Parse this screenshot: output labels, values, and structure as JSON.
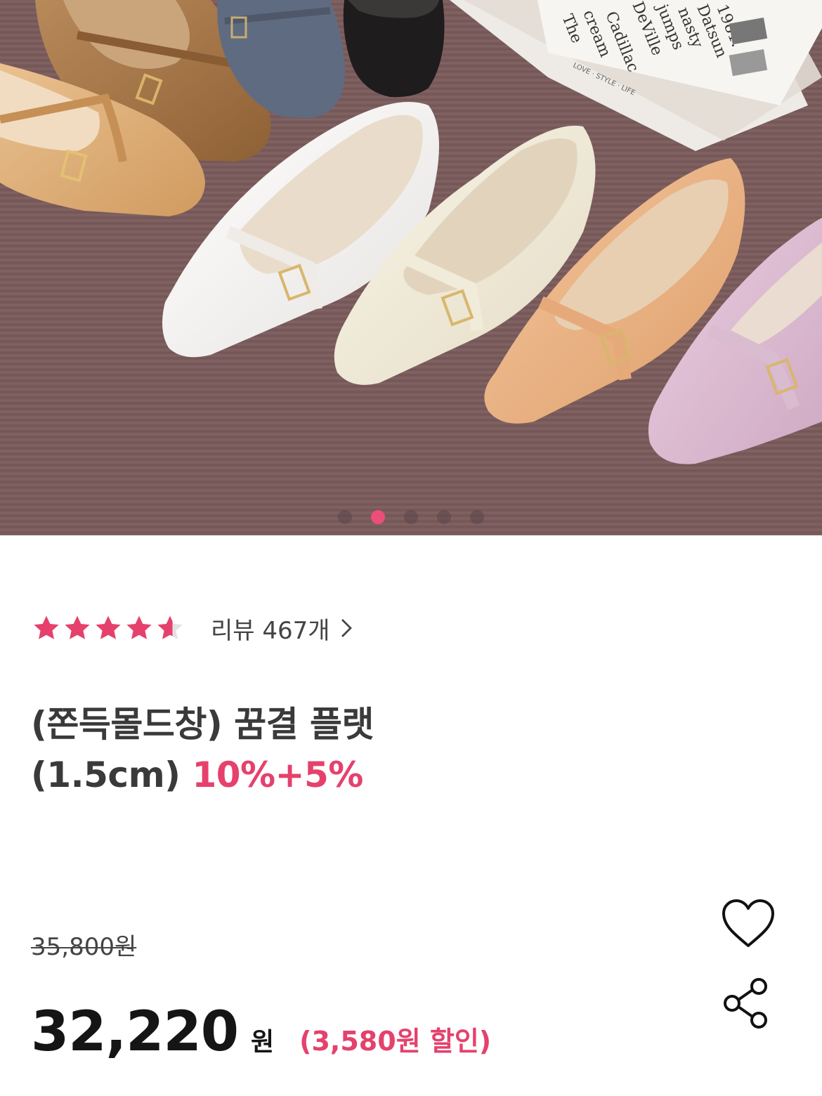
{
  "product_image": {
    "alt": "",
    "book_text": [
      "The",
      "cream",
      "Cadillac",
      "DeVille",
      "jumps",
      "nasty",
      "Datsun",
      "1981."
    ],
    "book_spine": "LOVE · STYLE · LIFE",
    "carousel": {
      "total": 5,
      "active_index": 1
    }
  },
  "rating": {
    "score": 4.6,
    "max": 5,
    "reviews_label": "리뷰 467개"
  },
  "product": {
    "title_line1": "(쫀득몰드창) 꿈결 플랫",
    "title_line2": "(1.5cm)",
    "promo": "10%+5%"
  },
  "pricing": {
    "original_price": "35,800원",
    "sale_price": "32,220",
    "currency": "원",
    "discount_label": "(3,580원 할인)"
  },
  "colors": {
    "accent": "#e5416c",
    "active_dot": "#ea4e79",
    "carpet": "#7a5b5c"
  },
  "icons": {
    "wishlist": "heart-icon",
    "share": "share-icon",
    "review_arrow": "chevron-right-icon"
  }
}
